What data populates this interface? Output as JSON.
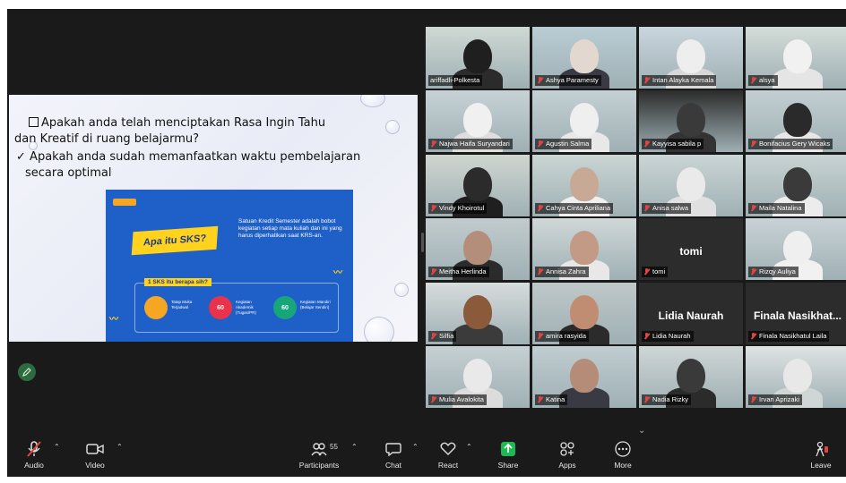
{
  "slide": {
    "line1": "Apakah anda telah menciptakan Rasa Ingin Tahu",
    "line1b": "dan Kreatif di ruang belajarmu?",
    "line2": "Apakah anda sudah memanfaatkan waktu pembelajaran",
    "line2b": "secara optimal",
    "check_glyph": "✓",
    "inner": {
      "banner": "Apa itu SKS?",
      "description": "Satuan Kredit Semester adalah bobot kegiatan setiap mata kuliah dan ini yang harus diperhatikan saat KRS-an.",
      "panel_label": "1 SKS itu berapa sih?",
      "items": [
        {
          "value": "",
          "desc": "Tatap Muka Terjadwal"
        },
        {
          "value": "60",
          "desc": "Kegiatan Akademik (Tugas/PR)"
        },
        {
          "value": "60",
          "desc": "Kegiatan Mandiri (Belajar Sendiri)"
        }
      ]
    }
  },
  "participants": [
    {
      "name": "ariffadli-Polkesta",
      "muted": false
    },
    {
      "name": "Ashya Paramesty",
      "muted": true
    },
    {
      "name": "Intan Alayka Kemala",
      "muted": true
    },
    {
      "name": "alsya",
      "muted": true
    },
    {
      "name": "Najwa Haifa Suryandari",
      "muted": true
    },
    {
      "name": "Agustin Salma",
      "muted": true
    },
    {
      "name": "Kayyisa sabila p",
      "muted": true
    },
    {
      "name": "Bonifacius Gery Wicaks",
      "muted": true
    },
    {
      "name": "Vindy Khoirotul",
      "muted": true
    },
    {
      "name": "Cahya Cinta Apriliana",
      "muted": true
    },
    {
      "name": "Anisa salwa",
      "muted": true
    },
    {
      "name": "Maila Natalina",
      "muted": true
    },
    {
      "name": "Meitha Herlinda",
      "muted": true
    },
    {
      "name": "Annisa Zahra",
      "muted": true
    },
    {
      "name": "tomi",
      "muted": true,
      "display": "tomi"
    },
    {
      "name": "Rizqy Auliya",
      "muted": true
    },
    {
      "name": "Silfia",
      "muted": true
    },
    {
      "name": "amira rasyida",
      "muted": true
    },
    {
      "name": "Lidia Naurah",
      "muted": true,
      "display": "Lidia Naurah"
    },
    {
      "name": "Finala Nasikhatul Laila",
      "muted": true,
      "display": "Finala Nasikhat..."
    },
    {
      "name": "Mulia Avalokita",
      "muted": true
    },
    {
      "name": "Katina",
      "muted": true
    },
    {
      "name": "Nadia Rizky",
      "muted": true
    },
    {
      "name": "Irvan Aprizaki",
      "muted": true
    }
  ],
  "toolbar": {
    "audio": "Audio",
    "video": "Video",
    "participants": "Participants",
    "participants_count": "55",
    "chat": "Chat",
    "react": "React",
    "share": "Share",
    "apps": "Apps",
    "more": "More",
    "leave": "Leave"
  },
  "colors": {
    "toolbar_bg": "#1a1a1a",
    "active_speaker": "#2ecc71",
    "share_green": "#1db954",
    "muted_red": "#e04545"
  }
}
